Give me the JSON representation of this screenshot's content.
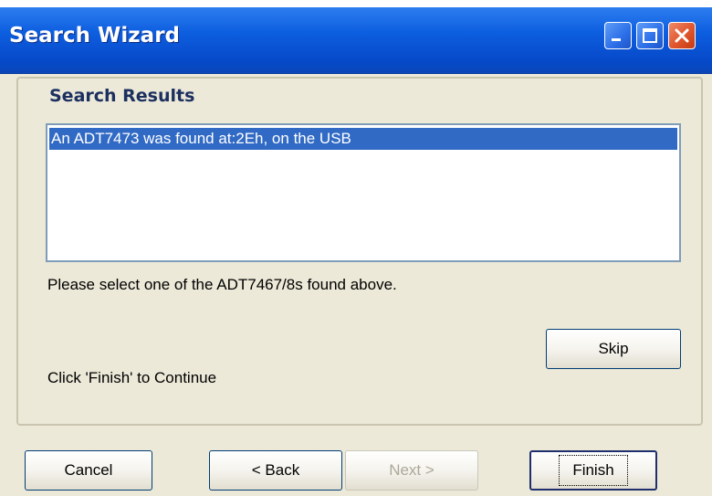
{
  "window": {
    "title": "Search Wizard"
  },
  "section": {
    "heading": "Search Results"
  },
  "results": {
    "items": [
      "An ADT7473 was found at:2Eh, on the USB"
    ]
  },
  "instruction_text": "Please select one of the ADT7467/8s found above.",
  "continue_text": "Click 'Finish' to Continue",
  "buttons": {
    "skip": "Skip",
    "cancel": "Cancel",
    "back": "< Back",
    "next": "Next >",
    "finish": "Finish"
  },
  "colors": {
    "titlebar": "#0a5fd8",
    "selection": "#316ac5",
    "dialog_background": "#ece9d8"
  },
  "icons": [
    "minimize-icon",
    "maximize-icon",
    "close-icon"
  ]
}
